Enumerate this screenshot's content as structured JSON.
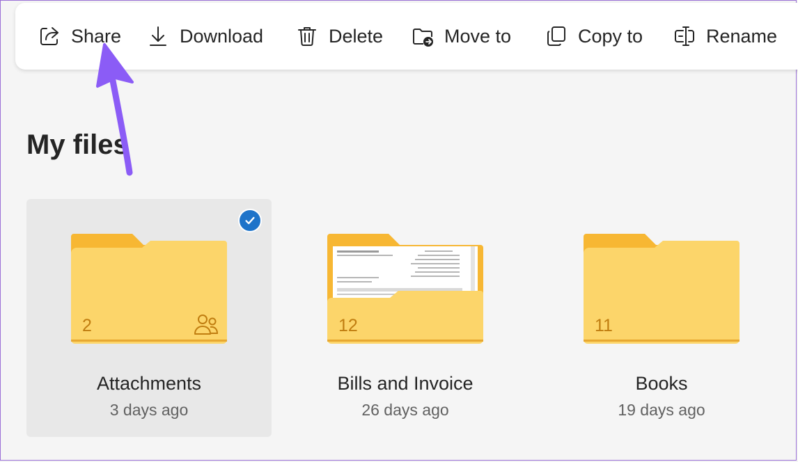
{
  "toolbar": {
    "share_label": "Share",
    "download_label": "Download",
    "delete_label": "Delete",
    "move_label": "Move to",
    "copy_label": "Copy to",
    "rename_label": "Rename"
  },
  "main": {
    "title": "My files",
    "folders": [
      {
        "name": "Attachments",
        "modified": "3 days ago",
        "count": "2",
        "selected": true,
        "shared": true
      },
      {
        "name": "Bills and Invoice",
        "modified": "26 days ago",
        "count": "12",
        "selected": false,
        "shared": false
      },
      {
        "name": "Books",
        "modified": "19 days ago",
        "count": "11",
        "selected": false,
        "shared": false
      }
    ]
  },
  "icons": [
    "share-icon",
    "download-icon",
    "delete-icon",
    "move-icon",
    "copy-icon",
    "rename-icon",
    "folder-icon",
    "shared-people-icon",
    "checkmark-icon"
  ],
  "colors": {
    "accent": "#1e73c9",
    "folder_front": "#fcd56a",
    "folder_back": "#f7b733",
    "count_text": "#c07d10",
    "annotation_arrow": "#8b5cf6"
  }
}
